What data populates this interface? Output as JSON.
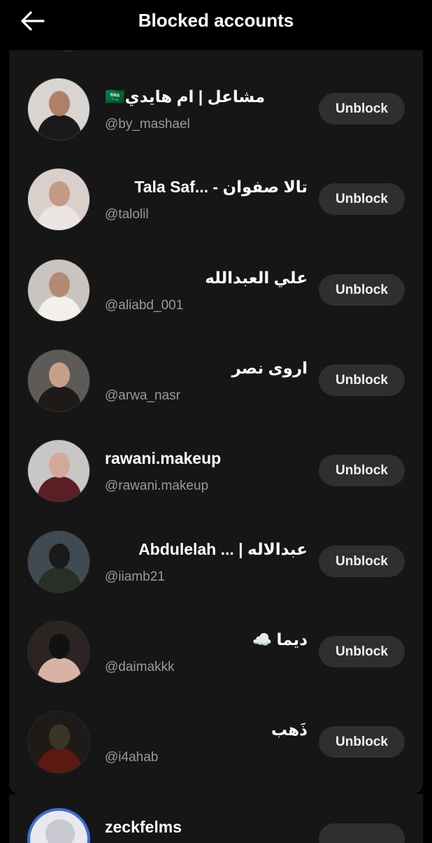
{
  "header": {
    "title": "Blocked accounts",
    "back_icon": "arrow-left-icon"
  },
  "accounts": [
    {
      "name": "🇸🇦مشاعل | ام هايدي",
      "handle": "@by_mashael",
      "button": "Unblock",
      "avatar_colors": [
        "#d8d4d2",
        "#1a1a1a",
        "#b07f68"
      ]
    },
    {
      "name": "تالا صفوان - ...Tala Saf",
      "handle": "@talolil",
      "button": "Unblock",
      "avatar_colors": [
        "#d9d0cc",
        "#ebe4e0",
        "#c49a86"
      ]
    },
    {
      "name": "علي العبدالله",
      "handle": "@aliabd_001",
      "button": "Unblock",
      "avatar_colors": [
        "#c9c4c0",
        "#f3f0ec",
        "#b48a74"
      ]
    },
    {
      "name": "اروى نصر",
      "handle": "@arwa_nasr",
      "button": "Unblock",
      "avatar_colors": [
        "#5d5a58",
        "#1e1a18",
        "#c7a08c"
      ]
    },
    {
      "name": "rawani.makeup",
      "handle": "@rawani.makeup",
      "button": "Unblock",
      "avatar_colors": [
        "#c9c6c6",
        "#5a1e24",
        "#d2a898"
      ]
    },
    {
      "name": "عبدالاله | ... Abdulelah",
      "handle": "@iiamb21",
      "button": "Unblock",
      "avatar_colors": [
        "#3f4a52",
        "#2a2f25",
        "#1a1a1a"
      ]
    },
    {
      "name": "ديما ☁️",
      "handle": "@daimakkk",
      "button": "Unblock",
      "avatar_colors": [
        "#2b2422",
        "#d6b3a3",
        "#111111"
      ]
    },
    {
      "name": "ذَهب",
      "handle": "@i4ahab",
      "button": "Unblock",
      "avatar_colors": [
        "#1d1a17",
        "#5a1a12",
        "#3b3528"
      ]
    }
  ],
  "next_account": {
    "name": "zeckfelms",
    "avatar_colors": [
      "#3b6fd6",
      "#e8e8ee"
    ]
  }
}
